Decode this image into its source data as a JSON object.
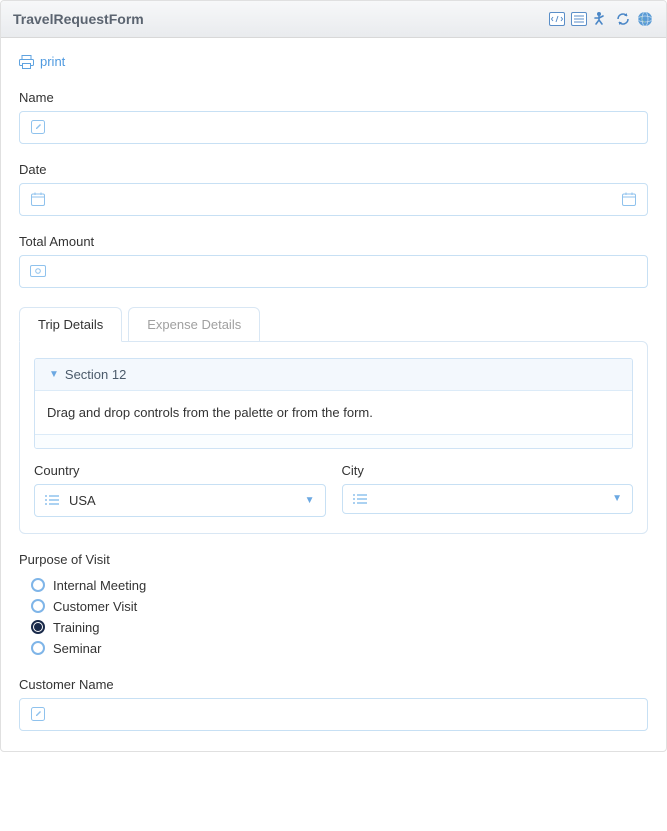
{
  "header": {
    "title": "TravelRequestForm"
  },
  "toolbar": {
    "print_label": "print"
  },
  "fields": {
    "name_label": "Name",
    "date_label": "Date",
    "total_amount_label": "Total Amount",
    "customer_name_label": "Customer Name"
  },
  "tabs": {
    "trip_details": "Trip Details",
    "expense_details": "Expense Details"
  },
  "section": {
    "title": "Section 12",
    "hint": "Drag and drop controls from the palette or from the form."
  },
  "country": {
    "label": "Country",
    "value": "USA"
  },
  "city": {
    "label": "City",
    "value": ""
  },
  "purpose": {
    "label": "Purpose of Visit",
    "options": [
      {
        "label": "Internal Meeting",
        "checked": false
      },
      {
        "label": "Customer Visit",
        "checked": false
      },
      {
        "label": "Training",
        "checked": true
      },
      {
        "label": "Seminar",
        "checked": false
      }
    ]
  }
}
